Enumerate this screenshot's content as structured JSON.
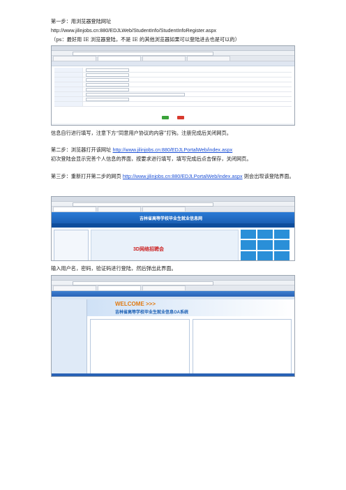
{
  "steps": {
    "step1_title": "第一步：用浏览器登陆网址",
    "step1_url": "http://www.jilinjobs.cn:880/EDJLWeb/StudentInfo/StudentInfoRegister.aspx",
    "step1_note": "（ps：最好用 IE 浏览器登陆，不是 IE 的其他浏览器如果可以登陆进去也是可以的）",
    "step1_after": "信息自行进行填写，注意下方“同意用户协议的内容”打钩。注册完成后关闭网页。",
    "step2_prefix": "第二步：浏览器打开该网址 ",
    "step2_url": "http://www.jilinjobs.cn:880/EDJLPortalWeb/index.aspx",
    "step2_desc": "初次登陆会显示完善个人信息的界面，按要求进行填写，填写完成后点击保存，关闭网页。",
    "step3_prefix": "第三步：重新打开第二步的网页 ",
    "step3_url": "http://www.jilinjobs.cn:880/EDJLPortalWeb/index.aspx",
    "step3_suffix": " 则会出现该登陆界面。",
    "step4_text": "输入用户名，密码，验证码进行登陆，然后弹出此界面。"
  },
  "shot2": {
    "site_title": "吉林省高等学校毕业生就业信息网",
    "banner_text": "3D网络招聘会"
  },
  "shot3": {
    "welcome": "WELCOME >>>",
    "system_name": "吉林省高等学校毕业生就业信息OA系统"
  }
}
